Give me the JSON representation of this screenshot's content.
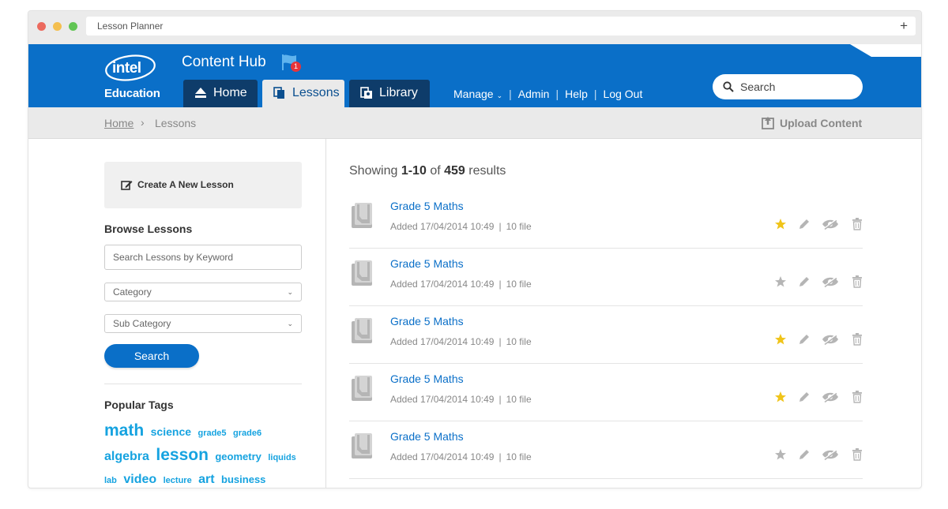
{
  "browser": {
    "url": "Lesson Planner",
    "new_tab": "+"
  },
  "brand": {
    "logo_text": "intel",
    "logo_sub": "Education",
    "hub_title": "Content Hub",
    "notification_count": "1"
  },
  "tabs": [
    {
      "label": "Home",
      "icon": "home-icon"
    },
    {
      "label": "Lessons",
      "icon": "lessons-icon",
      "active": true
    },
    {
      "label": "Library",
      "icon": "library-icon"
    }
  ],
  "nav": {
    "manage": "Manage",
    "admin": "Admin",
    "help": "Help",
    "logout": "Log Out",
    "separator": "|",
    "caret": "⌄"
  },
  "search": {
    "placeholder": "Search"
  },
  "breadcrumb": {
    "home": "Home",
    "separator": "›",
    "current": "Lessons"
  },
  "upload_label": "Upload Content",
  "sidebar": {
    "create_label": "Create A New Lesson",
    "browse_title": "Browse Lessons",
    "keyword_placeholder": "Search Lessons by Keyword",
    "category": "Category",
    "subcategory": "Sub Category",
    "chevron": "⌄",
    "search_button": "Search",
    "tags_title": "Popular Tags",
    "tags": [
      {
        "text": "math",
        "size": 21
      },
      {
        "text": "science",
        "size": 14
      },
      {
        "text": "grade5",
        "size": 11
      },
      {
        "text": "grade6",
        "size": 11
      },
      {
        "text": "algebra",
        "size": 16
      },
      {
        "text": "lesson",
        "size": 21
      },
      {
        "text": "geometry",
        "size": 13
      },
      {
        "text": "liquids",
        "size": 11
      },
      {
        "text": "lab",
        "size": 11
      },
      {
        "text": "video",
        "size": 16
      },
      {
        "text": "lecture",
        "size": 11
      },
      {
        "text": "art",
        "size": 16
      },
      {
        "text": "business",
        "size": 13
      }
    ]
  },
  "results": {
    "prefix": "Showing",
    "range": "1-10",
    "of": "of",
    "total": "459",
    "suffix": "results",
    "items": [
      {
        "title": "Grade 5 Maths",
        "added": "Added 17/04/2014 10:49",
        "separator": "|",
        "files": "10 file",
        "starred": true
      },
      {
        "title": "Grade 5 Maths",
        "added": "Added 17/04/2014 10:49",
        "separator": "|",
        "files": "10 file",
        "starred": false
      },
      {
        "title": "Grade 5 Maths",
        "added": "Added 17/04/2014 10:49",
        "separator": "|",
        "files": "10 file",
        "starred": true
      },
      {
        "title": "Grade 5 Maths",
        "added": "Added 17/04/2014 10:49",
        "separator": "|",
        "files": "10 file",
        "starred": true
      },
      {
        "title": "Grade 5 Maths",
        "added": "Added 17/04/2014 10:49",
        "separator": "|",
        "files": "10 file",
        "starred": false
      }
    ]
  },
  "colors": {
    "primary": "#0a6fc8",
    "tab_dark": "#0e3c6a",
    "star_active": "#f0c419",
    "star_inactive": "#b5b5b5",
    "icon_gray": "#b5b5b5",
    "tag_blue": "#16a3e0",
    "dot_red": "#ec6a5e",
    "dot_yellow": "#f4bf4f",
    "dot_green": "#61c554"
  }
}
